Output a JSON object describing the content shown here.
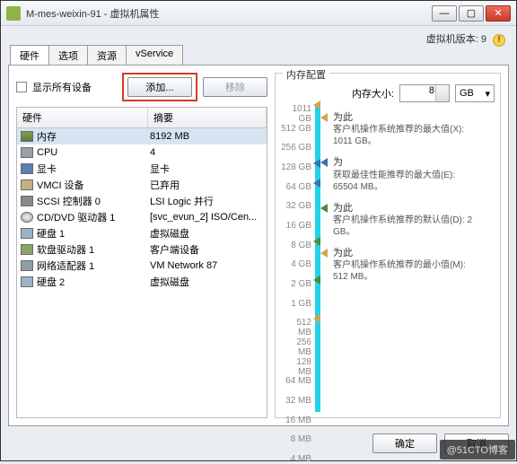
{
  "window": {
    "title": "M-mes-weixin-91 - 虚拟机属性",
    "version_label": "虚拟机版本: 9"
  },
  "tabs": [
    "硬件",
    "选项",
    "资源",
    "vService"
  ],
  "toolbar": {
    "show_all": "显示所有设备",
    "add": "添加...",
    "remove": "移除"
  },
  "table": {
    "headers": [
      "硬件",
      "摘要"
    ],
    "rows": [
      {
        "icon": "mem",
        "name": "内存",
        "summary": "8192 MB",
        "sel": true
      },
      {
        "icon": "cpu",
        "name": "CPU",
        "summary": "4"
      },
      {
        "icon": "vid",
        "name": "显卡",
        "summary": "显卡"
      },
      {
        "icon": "vmci",
        "name": "VMCI 设备",
        "summary": "已弃用"
      },
      {
        "icon": "scsi",
        "name": "SCSI 控制器 0",
        "summary": "LSI Logic 并行"
      },
      {
        "icon": "cd",
        "name": "CD/DVD 驱动器 1",
        "summary": "[svc_evun_2] ISO/Cen..."
      },
      {
        "icon": "disk",
        "name": "硬盘 1",
        "summary": "虚拟磁盘"
      },
      {
        "icon": "flop",
        "name": "软盘驱动器 1",
        "summary": "客户端设备"
      },
      {
        "icon": "net",
        "name": "网络适配器 1",
        "summary": "VM Network 87"
      },
      {
        "icon": "disk",
        "name": "硬盘 2",
        "summary": "虚拟磁盘"
      }
    ]
  },
  "memory": {
    "groupbox": "内存配置",
    "size_label": "内存大小:",
    "size_value": "8",
    "size_unit": "GB",
    "ticks": [
      "1011 GB",
      "512 GB",
      "256 GB",
      "128 GB",
      "64 GB",
      "32 GB",
      "16 GB",
      "8 GB",
      "4 GB",
      "2 GB",
      "1 GB",
      "512 MB",
      "256 MB",
      "128 MB",
      "64 MB",
      "32 MB",
      "16 MB",
      "8 MB",
      "4 MB"
    ],
    "annotations": [
      {
        "color": "#d6a24a",
        "head": "为此",
        "text": "客户机操作系统推荐的最大值(X):",
        "val": "1011 GB。"
      },
      {
        "color": "#3a6fb0",
        "head": "为",
        "text": "获取最佳性能推荐的最大值(E):",
        "val": "65504 MB。"
      },
      {
        "color": "#4f8a3c",
        "head": "为此",
        "text": "客户机操作系统推荐的默认值(D): 2",
        "val": "GB。"
      },
      {
        "color": "#d6a24a",
        "head": "为此",
        "text": "客户机操作系统推荐的最小值(M):",
        "val": "512 MB。"
      }
    ]
  },
  "footer": {
    "ok": "确定",
    "cancel": "取消"
  },
  "watermark": "@51CTO博客"
}
